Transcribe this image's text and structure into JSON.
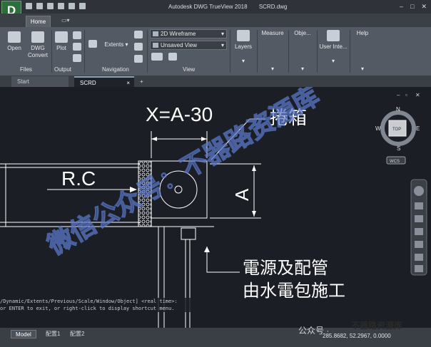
{
  "window": {
    "title": "Autodesk DWG TrueView 2018",
    "file": "SCRD.dwg",
    "app_letter": "D"
  },
  "ribbon": {
    "active_tab": "Home",
    "file_group": {
      "open": "Open",
      "convert_line1": "DWG",
      "convert_line2": "Convert",
      "label": "Files"
    },
    "output_group": {
      "plot": "Plot",
      "label": "Output"
    },
    "nav_group": {
      "extents": "Extents",
      "label": "Navigation"
    },
    "view_group": {
      "visual_style": "2D Wireframe",
      "named_view": "Unsaved View",
      "label": "View"
    },
    "layers": "Layers",
    "measure": "Measure",
    "objects": "Obje...",
    "user_interface": "User Inte...",
    "help": "Help"
  },
  "file_tabs": {
    "start": "Start",
    "active": "SCRD"
  },
  "viewcube": {
    "n": "N",
    "s": "S",
    "e": "E",
    "w": "W",
    "top": "TOP",
    "wcs": "WCS"
  },
  "drawing": {
    "dimension_text": "X=A-30",
    "reel_box": "捲箱",
    "rc_label": "R.C",
    "a_label": "A",
    "note_line1": "電源及配管",
    "note_line2": "由水電包施工",
    "watermark": "微信公众号：不器路资源库"
  },
  "command_history": {
    "line1": "/Dynamic/Extents/Previous/Scale/Window/Object] <real time>:",
    "line2": "or ENTER to exit, or right-click to display shortcut menu."
  },
  "status": {
    "model": "Model",
    "layout1": "配置1",
    "layout2": "配置2",
    "coordinates": "285.8682, 52.2967, 0.0000"
  },
  "watermark_footer": {
    "left": "公众号 ·",
    "right": "不器路资源库"
  },
  "colors": {
    "canvas": "#1b1f25",
    "ribbon": "#545a63",
    "drawing_lines": "#ffffff",
    "watermark": "#5b78c8"
  }
}
